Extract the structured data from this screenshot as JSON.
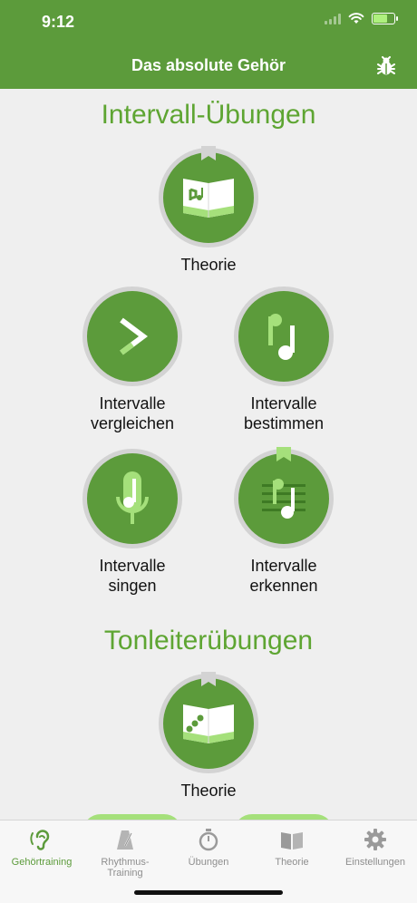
{
  "status_bar": {
    "time": "9:12"
  },
  "header": {
    "title": "Das absolute Gehör"
  },
  "sections": {
    "intervals": {
      "title": "Intervall-Übungen",
      "theory": "Theorie",
      "compare": "Intervalle\nvergleichen",
      "identify": "Intervalle\nbestimmen",
      "sing": "Intervalle\nsingen",
      "recognize": "Intervalle\nerkennen"
    },
    "scales": {
      "title": "Tonleiterübungen",
      "theory": "Theorie"
    }
  },
  "tabbar": {
    "tabs": [
      {
        "label": "Gehörtraining",
        "icon": "ear-icon",
        "active": true
      },
      {
        "label": "Rhythmus-Training",
        "icon": "metronome-icon",
        "active": false
      },
      {
        "label": "Übungen",
        "icon": "stopwatch-icon",
        "active": false
      },
      {
        "label": "Theorie",
        "icon": "book-icon",
        "active": false
      },
      {
        "label": "Einstellungen",
        "icon": "gear-icon",
        "active": false
      }
    ]
  },
  "colors": {
    "brand": "#5c9b3b",
    "title_green": "#5ea532",
    "tab_inactive": "#8e8e8e"
  }
}
